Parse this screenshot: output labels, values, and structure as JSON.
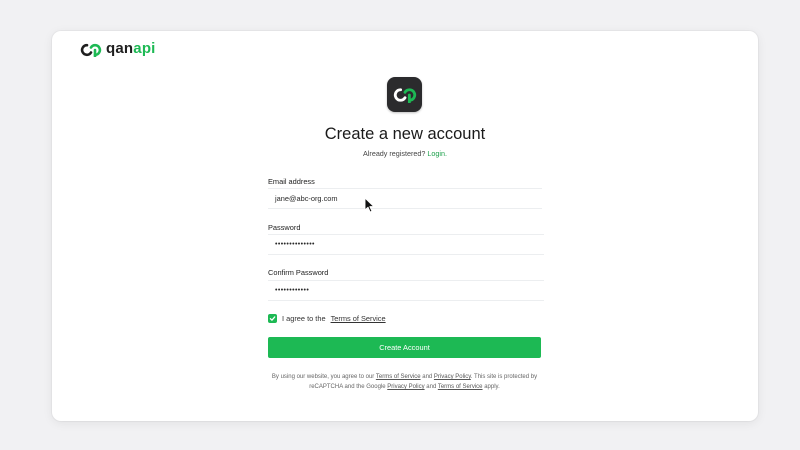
{
  "brand": {
    "name_prefix": "qan",
    "name_suffix": "api",
    "accent_color": "#1db954"
  },
  "icons": {
    "logo": "qanapi-infinity-logo-icon",
    "checkbox": "checkmark-icon",
    "cursor": "mouse-pointer-icon"
  },
  "header": {
    "title": "Create a new account",
    "subtitle_text": "Already registered?",
    "login_link": "Login."
  },
  "form": {
    "email": {
      "label": "Email address",
      "value": "jane@abc-org.com"
    },
    "password": {
      "label": "Password",
      "value": "••••••••••••••"
    },
    "confirm_password": {
      "label": "Confirm Password",
      "value": "••••••••••••"
    },
    "agree": {
      "checked": true,
      "text": "I agree to the",
      "terms_link": "Terms of Service"
    },
    "submit_label": "Create Account"
  },
  "legal": {
    "part1": "By using our website, you agree to our",
    "terms_link_1": "Terms of Service",
    "and_1": "and",
    "privacy_link_1": "Privacy Policy",
    "part2": ". This site is protected by reCAPTCHA and the Google",
    "privacy_link_2": "Privacy Policy",
    "and_2": "and",
    "terms_link_2": "Terms of Service",
    "part3": "apply."
  }
}
